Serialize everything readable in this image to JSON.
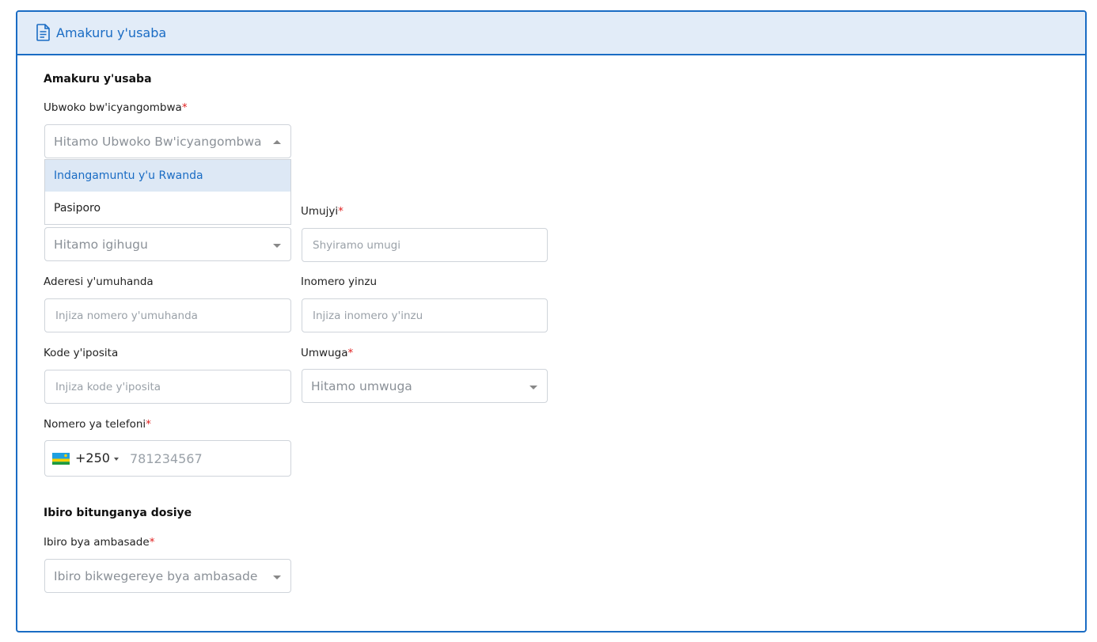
{
  "header": {
    "title": "Amakuru y'usaba",
    "icon": "document-icon"
  },
  "section1": {
    "title": "Amakuru y'usaba"
  },
  "document_type": {
    "label": "Ubwoko bw'icyangombwa",
    "required_mark": "*",
    "placeholder": "Hitamo Ubwoko Bw'icyangombwa",
    "options": [
      "Indangamuntu y'u Rwanda",
      "Pasiporo"
    ]
  },
  "country": {
    "placeholder": "Hitamo igihugu"
  },
  "city": {
    "label": "Umujyi",
    "required_mark": "*",
    "placeholder": "Shyiramo umugi"
  },
  "street": {
    "label": "Aderesi y'umuhanda",
    "placeholder": "Injiza nomero y'umuhanda"
  },
  "house": {
    "label": "Inomero yinzu",
    "placeholder": "Injiza inomero y'inzu"
  },
  "postal": {
    "label": "Kode y'iposita",
    "placeholder": "Injiza kode y'iposita"
  },
  "occupation": {
    "label": "Umwuga",
    "required_mark": "*",
    "placeholder": "Hitamo umwuga"
  },
  "phone": {
    "label": "Nomero ya telefoni",
    "required_mark": "*",
    "dial_code": "+250",
    "placeholder": "781234567",
    "flag": "rwanda-flag-icon"
  },
  "section2": {
    "title": "Ibiro bitunganya dosiye"
  },
  "embassy": {
    "label": "Ibiro bya ambasade",
    "required_mark": "*",
    "placeholder": "Ibiro bikwegereye bya ambasade"
  },
  "colors": {
    "accent": "#1a6cc4",
    "header_bg": "#e2ecf8",
    "required": "#e02020",
    "option_highlight": "#dde8f5"
  }
}
